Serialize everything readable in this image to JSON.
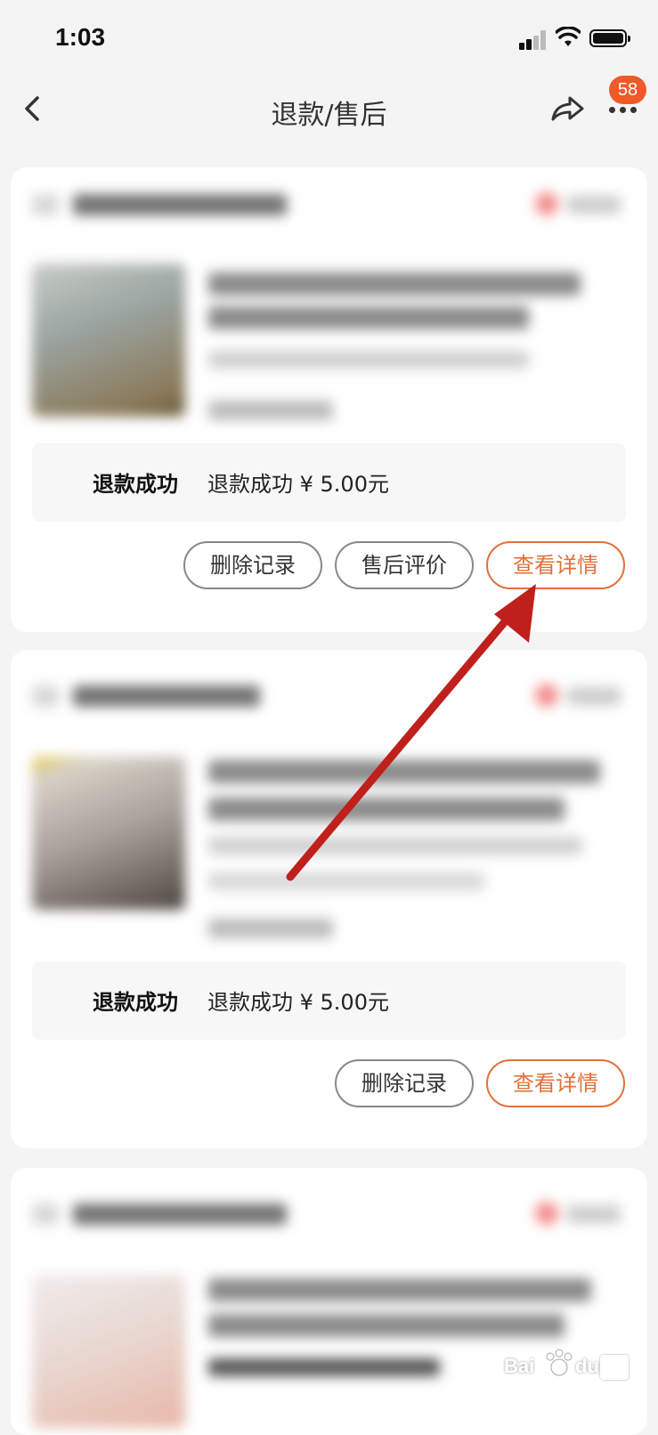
{
  "status_bar": {
    "time": "1:03"
  },
  "nav": {
    "title": "退款/售后",
    "badge": "58"
  },
  "cards": [
    {
      "refund_label": "退款成功",
      "refund_text": "退款成功 ¥ 5.00元",
      "buttons": [
        "删除记录",
        "售后评价",
        "查看详情"
      ]
    },
    {
      "refund_label": "退款成功",
      "refund_text": "退款成功 ¥ 5.00元",
      "buttons": [
        "删除记录",
        "查看详情"
      ]
    }
  ],
  "colors": {
    "accent": "#e2703a",
    "badge": "#f05a28",
    "arrow": "#c0201c"
  },
  "icons": [
    "back-icon",
    "share-icon",
    "more-icon",
    "signal-icon",
    "wifi-icon",
    "battery-icon"
  ]
}
